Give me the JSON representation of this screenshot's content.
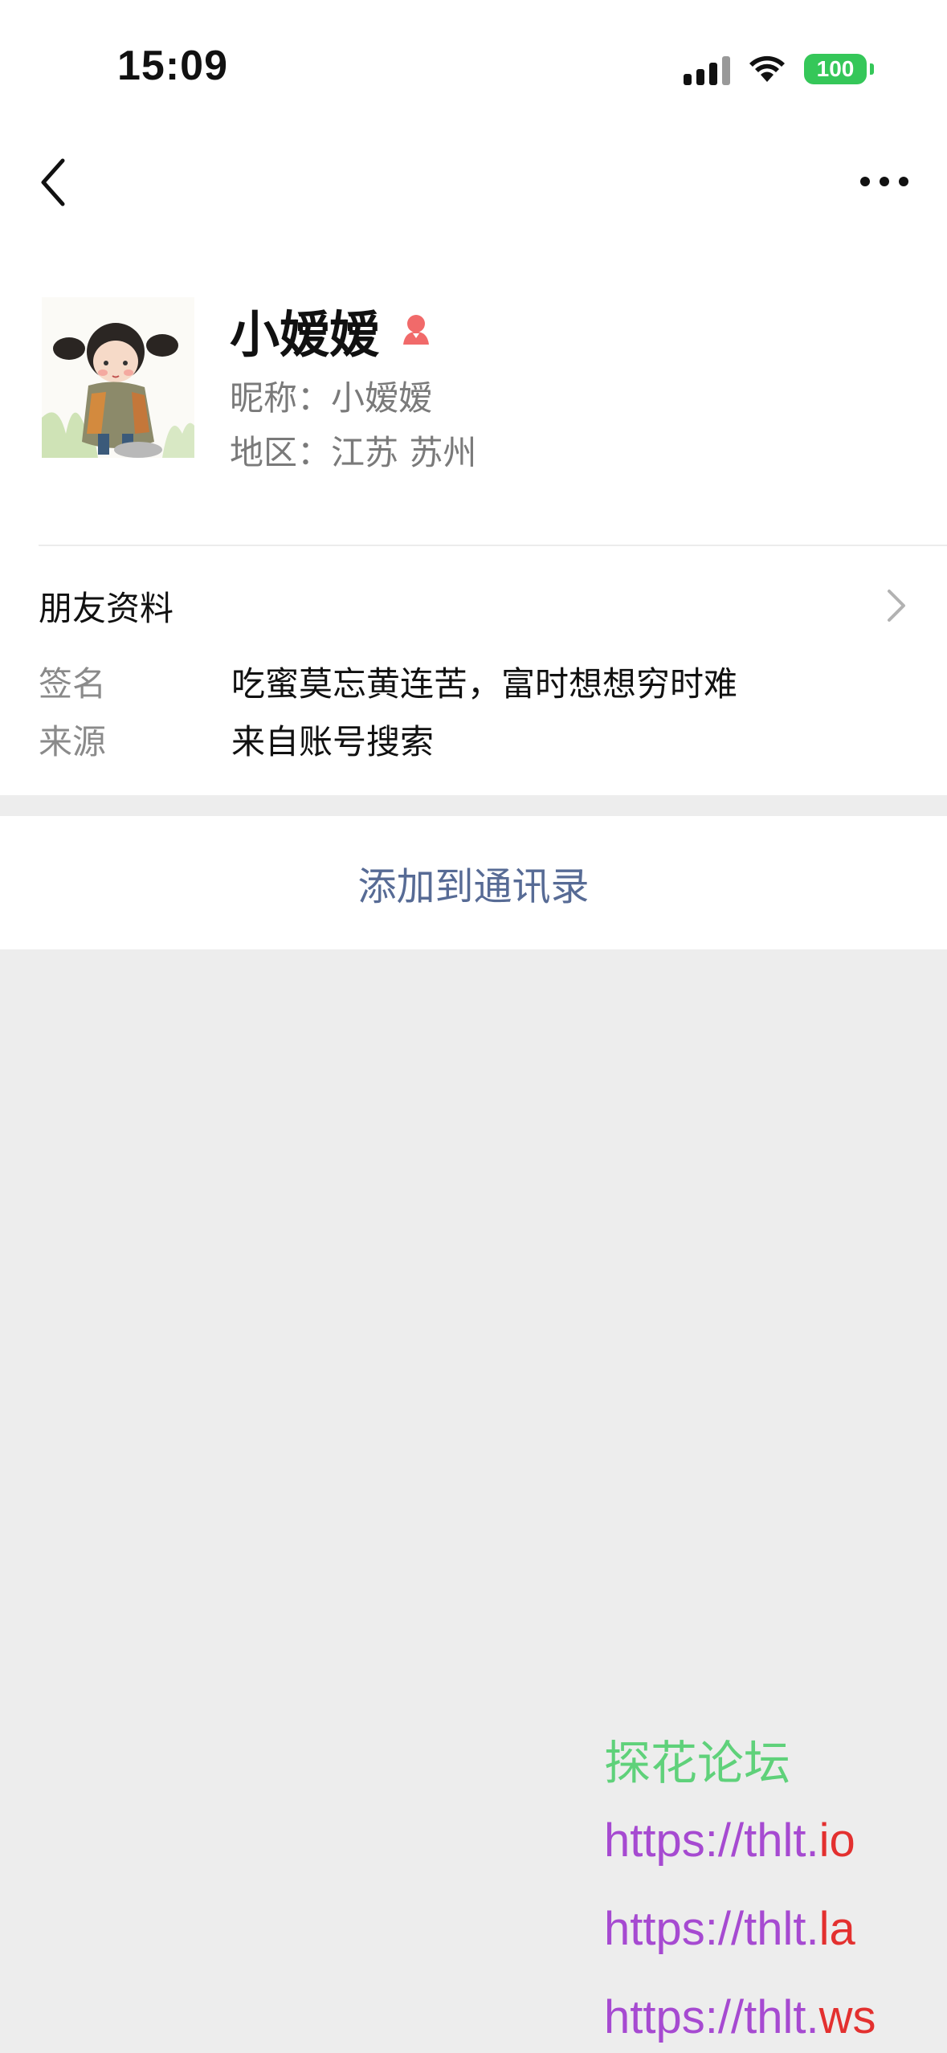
{
  "status_bar": {
    "time": "15:09",
    "battery": "100",
    "battery_color": "#35c759"
  },
  "nav": {
    "back_icon": "chevron-left-icon",
    "more_icon": "more-dots-icon"
  },
  "profile": {
    "name": "小嫒嫒",
    "gender_icon": "female-icon",
    "gender_color": "#f16a6a",
    "nickname": "昵称：小嫒嫒",
    "region": "地区：江苏 苏州"
  },
  "friend_info": {
    "title": "朋友资料",
    "signature_label": "签名",
    "signature_value": "吃蜜莫忘黄连苦，富时想想穷时难",
    "source_label": "来源",
    "source_value": "来自账号搜索"
  },
  "actions": {
    "add_contact": "添加到通讯录",
    "link_color": "#576b95"
  },
  "watermark": {
    "title": "探花论坛",
    "links": [
      {
        "prefix": "https://thlt.",
        "suffix": "io"
      },
      {
        "prefix": "https://thlt.",
        "suffix": "la"
      },
      {
        "prefix": "https://thlt.",
        "suffix": "ws"
      }
    ]
  }
}
